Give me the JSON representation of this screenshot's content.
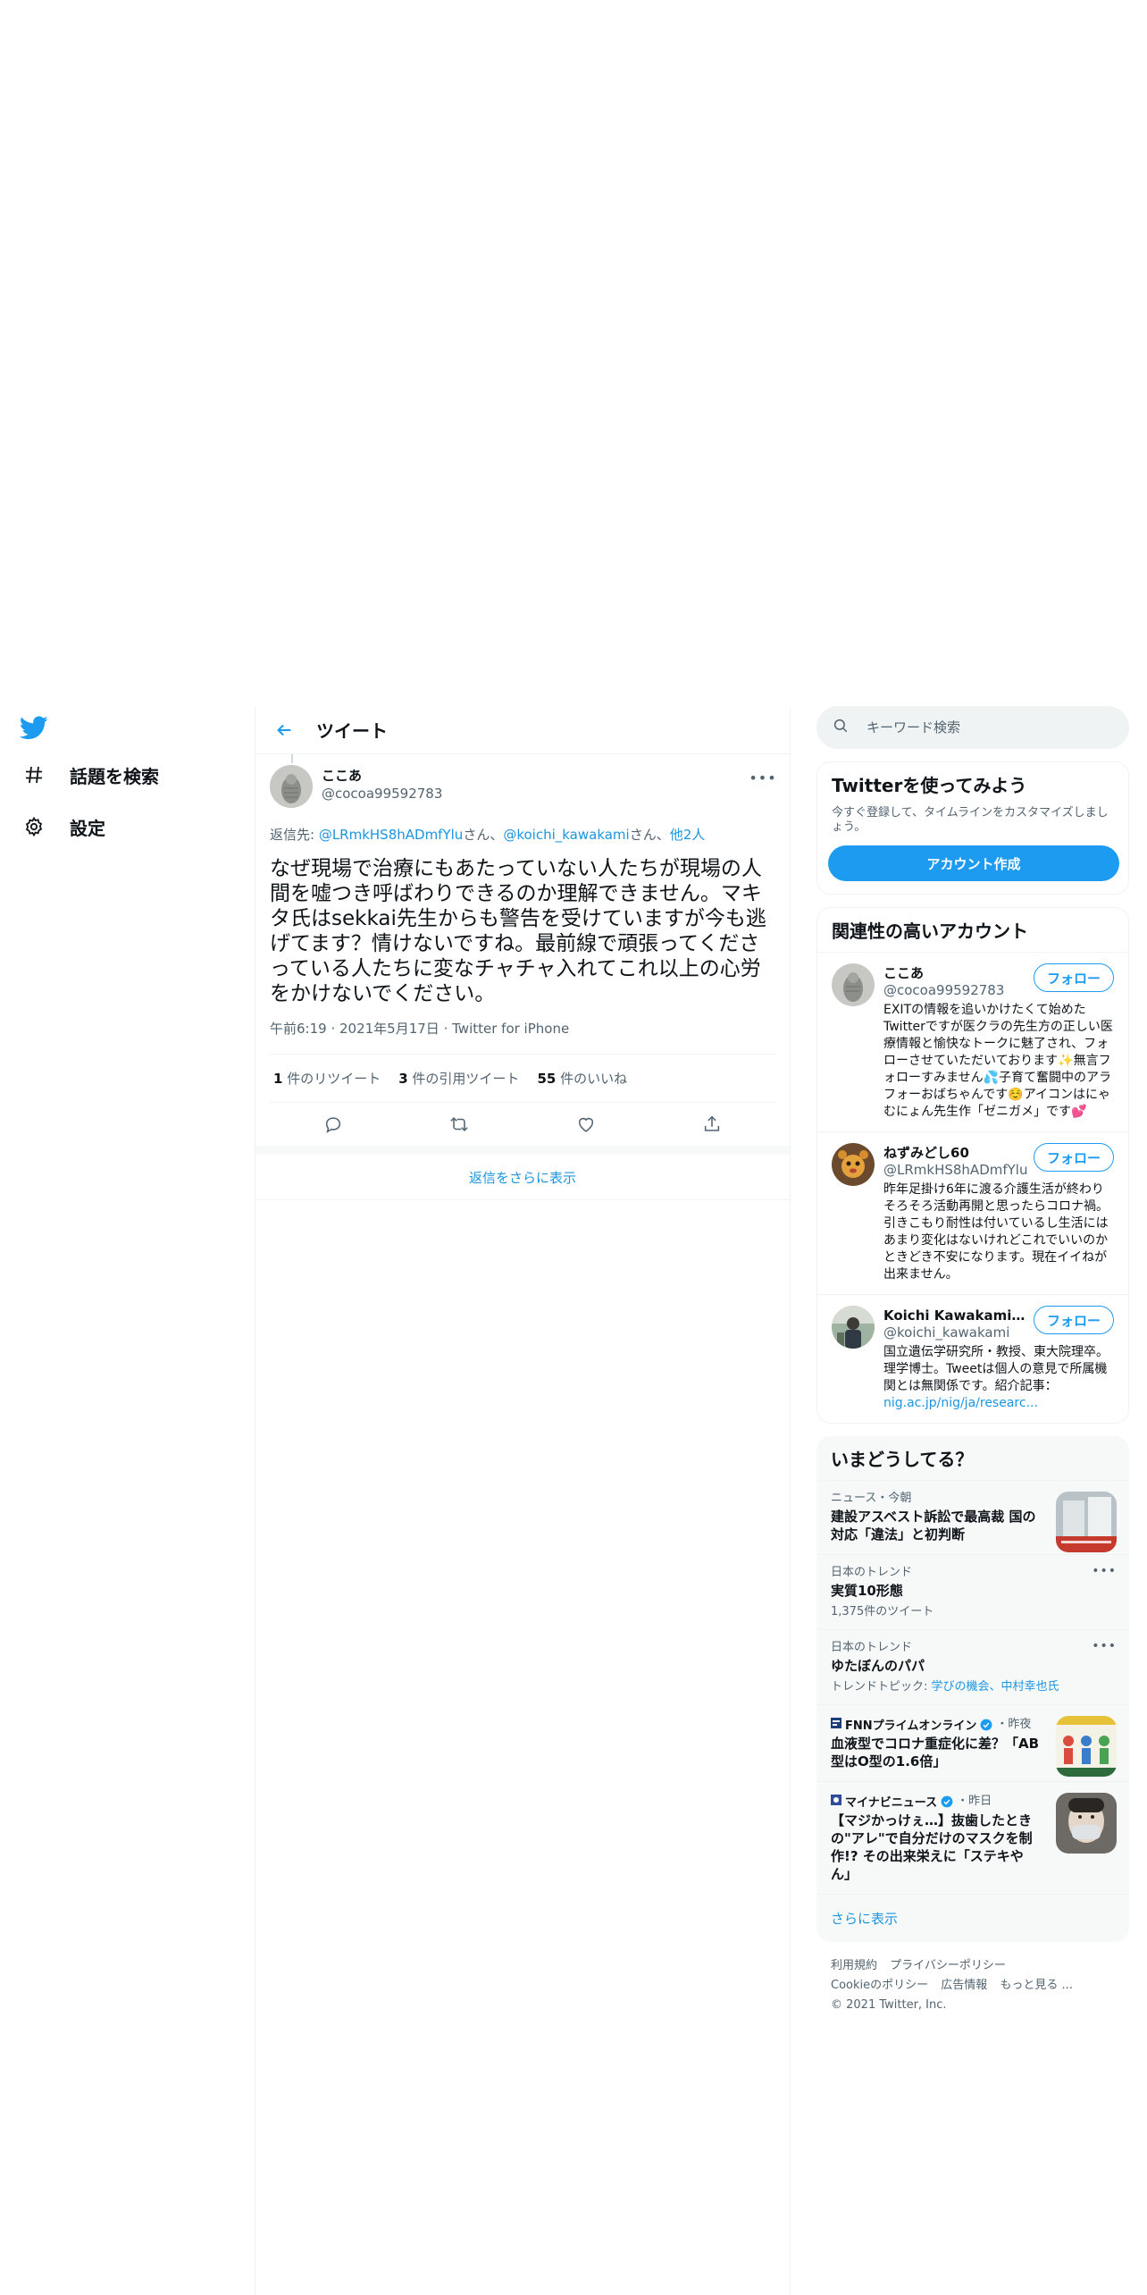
{
  "nav": {
    "items": [
      {
        "label": "話題を検索",
        "icon": "hashtag-icon"
      },
      {
        "label": "設定",
        "icon": "gear-icon"
      }
    ]
  },
  "header": {
    "title": "ツイート"
  },
  "tweet": {
    "display_name": "ここあ",
    "handle": "@cocoa99592783",
    "reply_prefix": "返信先: ",
    "reply_users": [
      "@LRmkHS8hADmfYlu",
      "@koichi_kawakami"
    ],
    "reply_suffix_san": "さん、",
    "reply_others": "他2人",
    "text": "なぜ現場で治療にもあたっていない人たちが現場の人間を嘘つき呼ばわりできるのか理解できません。マキタ氏はsekkai先生からも警告を受けていますが今も逃げてます？情けないですね。最前線で頑張ってくださっている人たちに変なチャチャ入れてこれ以上の心労をかけないでください。",
    "time": "午前6:19",
    "date": "2021年5月17日",
    "source": "Twitter for iPhone",
    "sep": " · ",
    "retweets_count": "1",
    "retweets_label": " 件のリツイート",
    "quotes_count": "3",
    "quotes_label": " 件の引用ツイート",
    "likes_count": "55",
    "likes_label": " 件のいいね"
  },
  "show_more_replies": "返信をさらに表示",
  "search": {
    "placeholder": "キーワード検索"
  },
  "signup": {
    "title": "Twitterを使ってみよう",
    "subtitle": "今すぐ登録して、タイムラインをカスタマイズしましょう。",
    "button": "アカウント作成"
  },
  "related": {
    "title": "関連性の高いアカウント",
    "follow_label": "フォロー",
    "accounts": [
      {
        "name": "ここあ",
        "handle": "@cocoa99592783",
        "bio": "EXITの情報を追いかけたくて始めたTwitterですが医クラの先生方の正しい医療情報と愉快なトークに魅了され、フォローさせていただいております✨無言フォローすみません💦子育て奮闘中のアラフォーおばちゃんです☺️アイコンはにゃむにょん先生作「ゼニガメ」です💕"
      },
      {
        "name": "ねずみどし60",
        "handle": "@LRmkHS8hADmfYlu",
        "bio": "昨年足掛け6年に渡る介護生活が終わり そろそろ活動再開と思ったらコロナ禍。 引きこもり耐性は付いているし生活には あまり変化はないけれどこれでいいのか ときどき不安になります。現在イイねが出来ません。"
      },
      {
        "name": "Koichi Kawakami, 川...",
        "handle": "@koichi_kawakami",
        "bio": "国立遺伝学研究所・教授、東大院理卒。理学博士。Tweetは個人の意見で所属機関とは無関係です。紹介記事：",
        "bio_link": "nig.ac.jp/nig/ja/researc..."
      }
    ]
  },
  "trends": {
    "title": "いまどうしてる？",
    "items": [
      {
        "context": "ニュース・今朝",
        "title": "建設アスベスト訴訟で最高裁 国の対応「違法」と初判断"
      },
      {
        "context": "日本のトレンド",
        "title": "実質10形態",
        "sub": "1,375件のツイート"
      },
      {
        "context": "日本のトレンド",
        "title": "ゆたぼんのパパ",
        "sub_prefix": "トレンドトピック: ",
        "sub_links": "学びの機会、中村幸也氏"
      },
      {
        "source": "FNNプライムオンライン",
        "time": "・昨夜",
        "title": "血液型でコロナ重症化に差？「AB型はO型の1.6倍」"
      },
      {
        "source": "マイナビニュース",
        "time": "・昨日",
        "title": "【マジかっけぇ…】抜歯したときの\"アレ\"で自分だけのマスクを制作!? その出来栄えに「ステキやん」"
      }
    ],
    "show_more": "さらに表示"
  },
  "footer": {
    "links": [
      "利用規約",
      "プライバシーポリシー",
      "Cookieのポリシー",
      "広告情報",
      "もっと見る ..."
    ],
    "copyright": "© 2021 Twitter, Inc."
  },
  "colors": {
    "accent": "#1d9bf0",
    "text": "#0f1419",
    "secondary": "#536471"
  }
}
